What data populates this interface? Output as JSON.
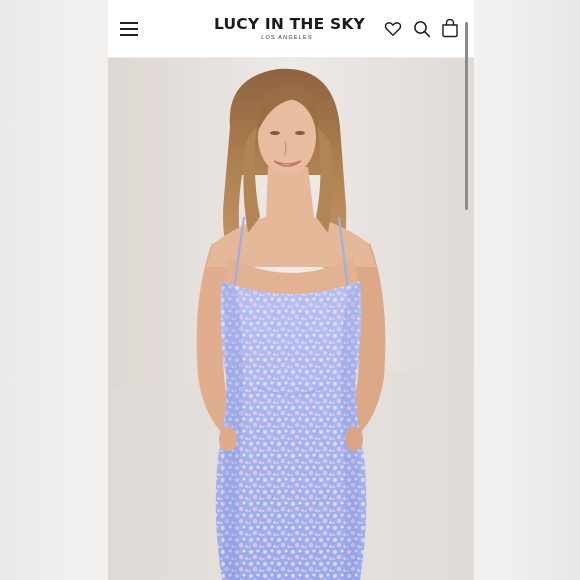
{
  "header": {
    "brand": "LUCY IN THE SKY",
    "location": "LOS ANGELES"
  },
  "icons": {
    "menu": "hamburger-menu-icon",
    "wishlist": "heart-icon",
    "search": "search-icon",
    "cart": "shopping-bag-icon"
  },
  "colors": {
    "dress": "#a9b5ee",
    "sequin_highlight": "#f4dbe8",
    "hair": "#a77a4d",
    "skin": "#e3b596",
    "background": "#e7e2de"
  }
}
